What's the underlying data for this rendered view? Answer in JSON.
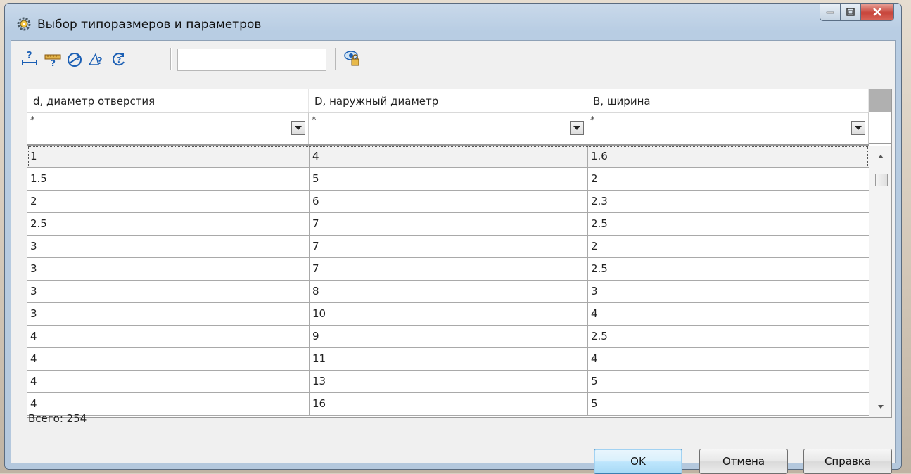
{
  "window": {
    "title": "Выбор типоразмеров и параметров"
  },
  "toolbar": {
    "icons": [
      "size-query-icon",
      "ruler-query-icon",
      "measure-query-icon",
      "angle-query-icon",
      "rotate-query-icon",
      "preview-icon"
    ],
    "search_value": ""
  },
  "table": {
    "columns": [
      "d, диаметр отверстия",
      "D, наружный диаметр",
      "B, ширина"
    ],
    "filters": [
      "*",
      "*",
      "*"
    ],
    "rows": [
      [
        "1",
        "4",
        "1.6"
      ],
      [
        "1.5",
        "5",
        "2"
      ],
      [
        "2",
        "6",
        "2.3"
      ],
      [
        "2.5",
        "7",
        "2.5"
      ],
      [
        "3",
        "7",
        "2"
      ],
      [
        "3",
        "7",
        "2.5"
      ],
      [
        "3",
        "8",
        "3"
      ],
      [
        "3",
        "10",
        "4"
      ],
      [
        "4",
        "9",
        "2.5"
      ],
      [
        "4",
        "11",
        "4"
      ],
      [
        "4",
        "13",
        "5"
      ],
      [
        "4",
        "16",
        "5"
      ]
    ],
    "selected_row": 0
  },
  "status": {
    "total": "Всего: 254"
  },
  "buttons": {
    "ok": "OK",
    "cancel": "Отмена",
    "help": "Справка"
  }
}
